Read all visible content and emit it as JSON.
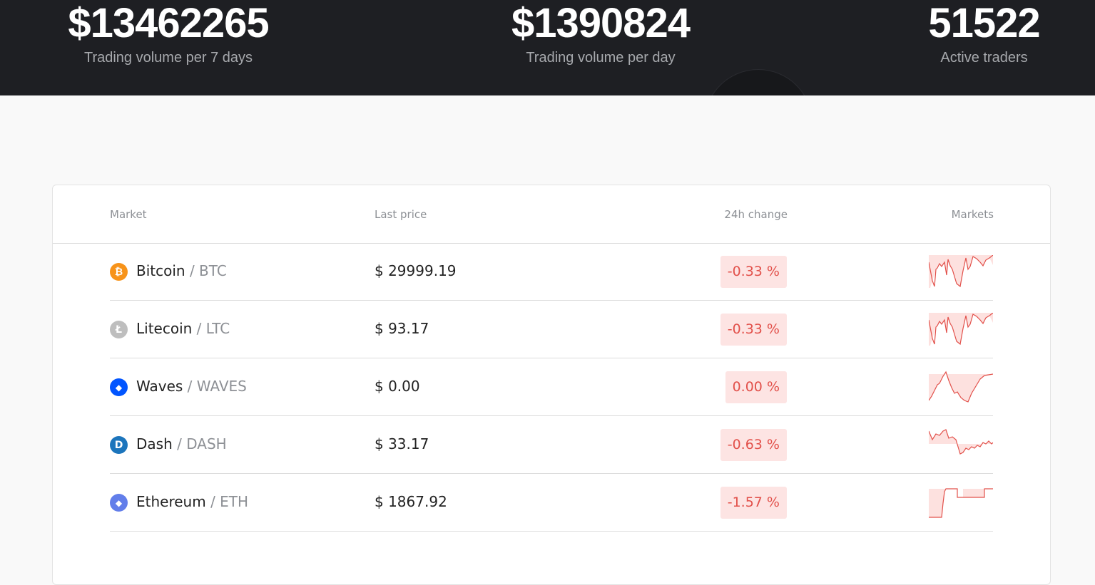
{
  "stats": [
    {
      "value": "$13462265",
      "label": "Trading volume per 7 days"
    },
    {
      "value": "$1390824",
      "label": "Trading volume per day"
    },
    {
      "value": "51522",
      "label": "Active traders"
    }
  ],
  "table": {
    "headers": {
      "market": "Market",
      "price": "Last price",
      "change": "24h change",
      "markets": "Markets"
    },
    "rows": [
      {
        "name": "Bitcoin",
        "symbol": "BTC",
        "price": "$ 29999.19",
        "change": "-0.33 %",
        "icon": "bitcoin-icon",
        "icon_color": "#f7931a",
        "icon_glyph": "₿"
      },
      {
        "name": "Litecoin",
        "symbol": "LTC",
        "price": "$ 93.17",
        "change": "-0.33 %",
        "icon": "litecoin-icon",
        "icon_color": "#bebebe",
        "icon_glyph": "Ł"
      },
      {
        "name": "Waves",
        "symbol": "WAVES",
        "price": "$ 0.00",
        "change": "0.00 %",
        "icon": "waves-icon",
        "icon_color": "#0155ff",
        "icon_glyph": "◆"
      },
      {
        "name": "Dash",
        "symbol": "DASH",
        "price": "$ 33.17",
        "change": "-0.63 %",
        "icon": "dash-icon",
        "icon_color": "#1c75bc",
        "icon_glyph": "D"
      },
      {
        "name": "Ethereum",
        "symbol": "ETH",
        "price": "$ 1867.92",
        "change": "-1.57 %",
        "icon": "ethereum-icon",
        "icon_color": "#627eea",
        "icon_glyph": "◆"
      }
    ]
  },
  "colors": {
    "banner_bg": "#1e1f23",
    "negative": "#e2504a",
    "negative_bg": "#fde4e3"
  }
}
